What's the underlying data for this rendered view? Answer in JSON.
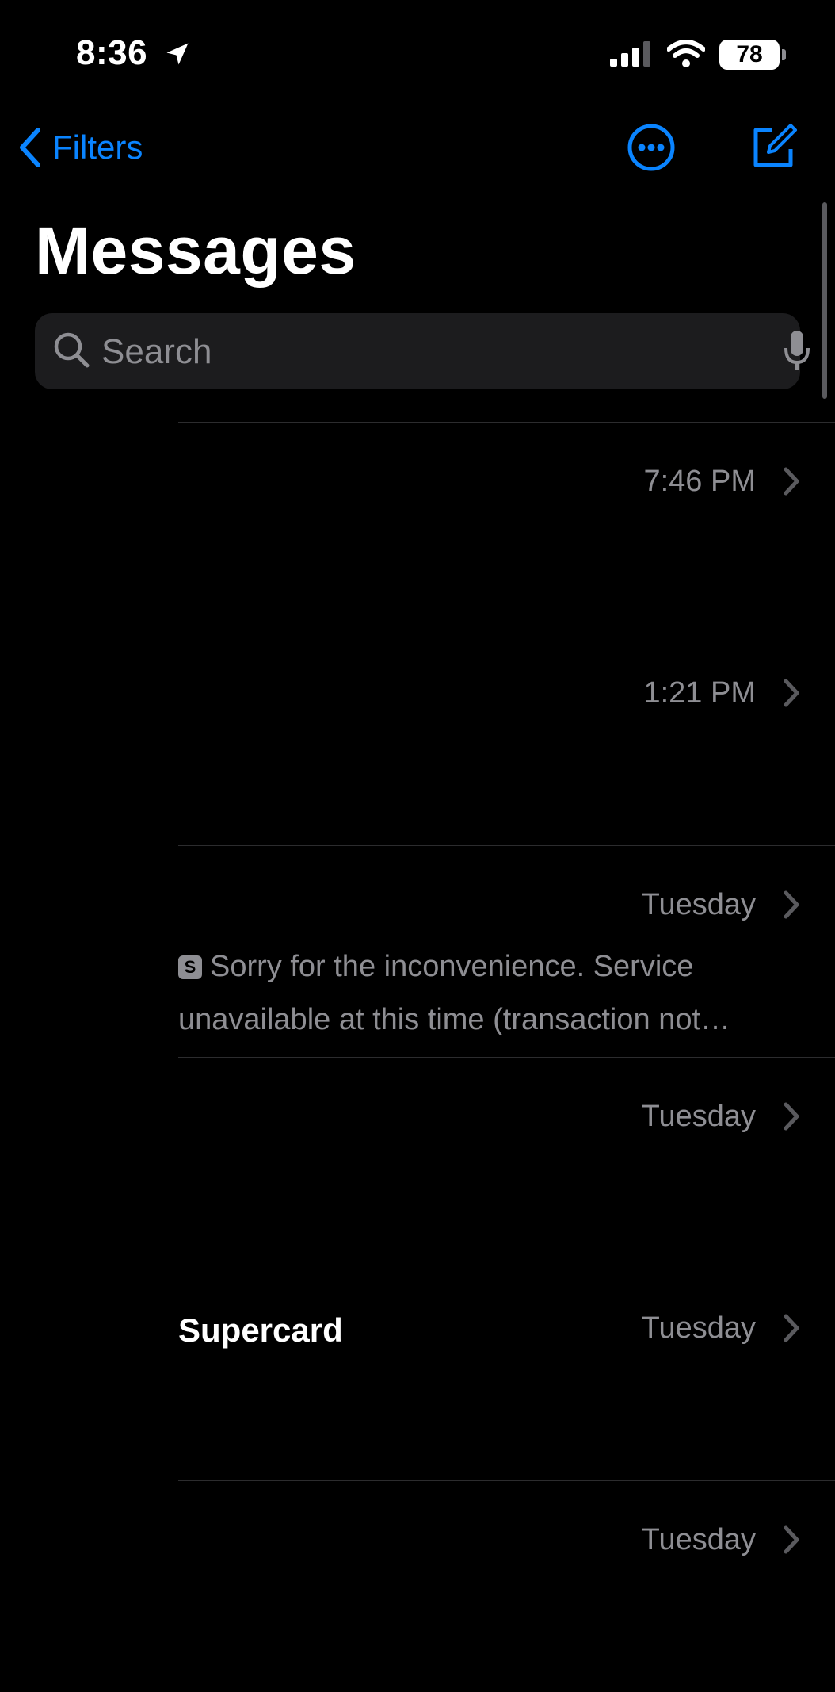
{
  "status_bar": {
    "time": "8:36",
    "battery": "78"
  },
  "nav": {
    "back_label": "Filters"
  },
  "page_title": "Messages",
  "search": {
    "placeholder": "Search"
  },
  "conversations": [
    {
      "name": "",
      "date": "7:46 PM",
      "preview": ""
    },
    {
      "name": "",
      "date": "1:21 PM",
      "preview": ""
    },
    {
      "name": "",
      "date": "Tuesday",
      "preview_badge": "S",
      "preview": "Sorry for the inconvenience. Service unavailable at this time (transaction not…"
    },
    {
      "name": "",
      "date": "Tuesday",
      "preview": ""
    },
    {
      "name": "Supercard",
      "date": "Tuesday",
      "preview": ""
    },
    {
      "name": "",
      "date": "Tuesday",
      "preview": ""
    }
  ],
  "colors": {
    "accent": "#0a84ff",
    "background": "#000000",
    "secondary_text": "#8e8e93",
    "search_bg": "#1c1c1e"
  }
}
